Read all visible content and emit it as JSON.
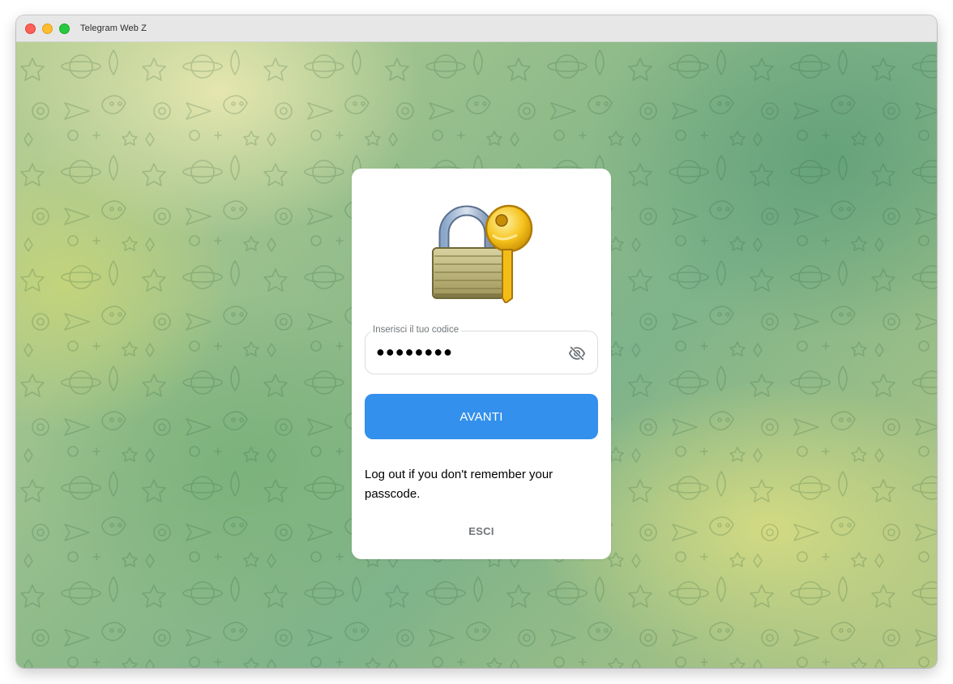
{
  "window": {
    "title": "Telegram Web Z"
  },
  "passcode_screen": {
    "input": {
      "label": "Inserisci il tuo codice",
      "masked_value": "●●●●●●●●"
    },
    "next_button_label": "AVANTI",
    "help_text": "Log out if you don't remember your passcode.",
    "logout_label": "ESCI"
  },
  "colors": {
    "accent": "#3390ec",
    "secondary_text": "#707579"
  },
  "icons": {
    "illustration": "lock-with-key",
    "password_toggle": "eye-off-icon"
  }
}
